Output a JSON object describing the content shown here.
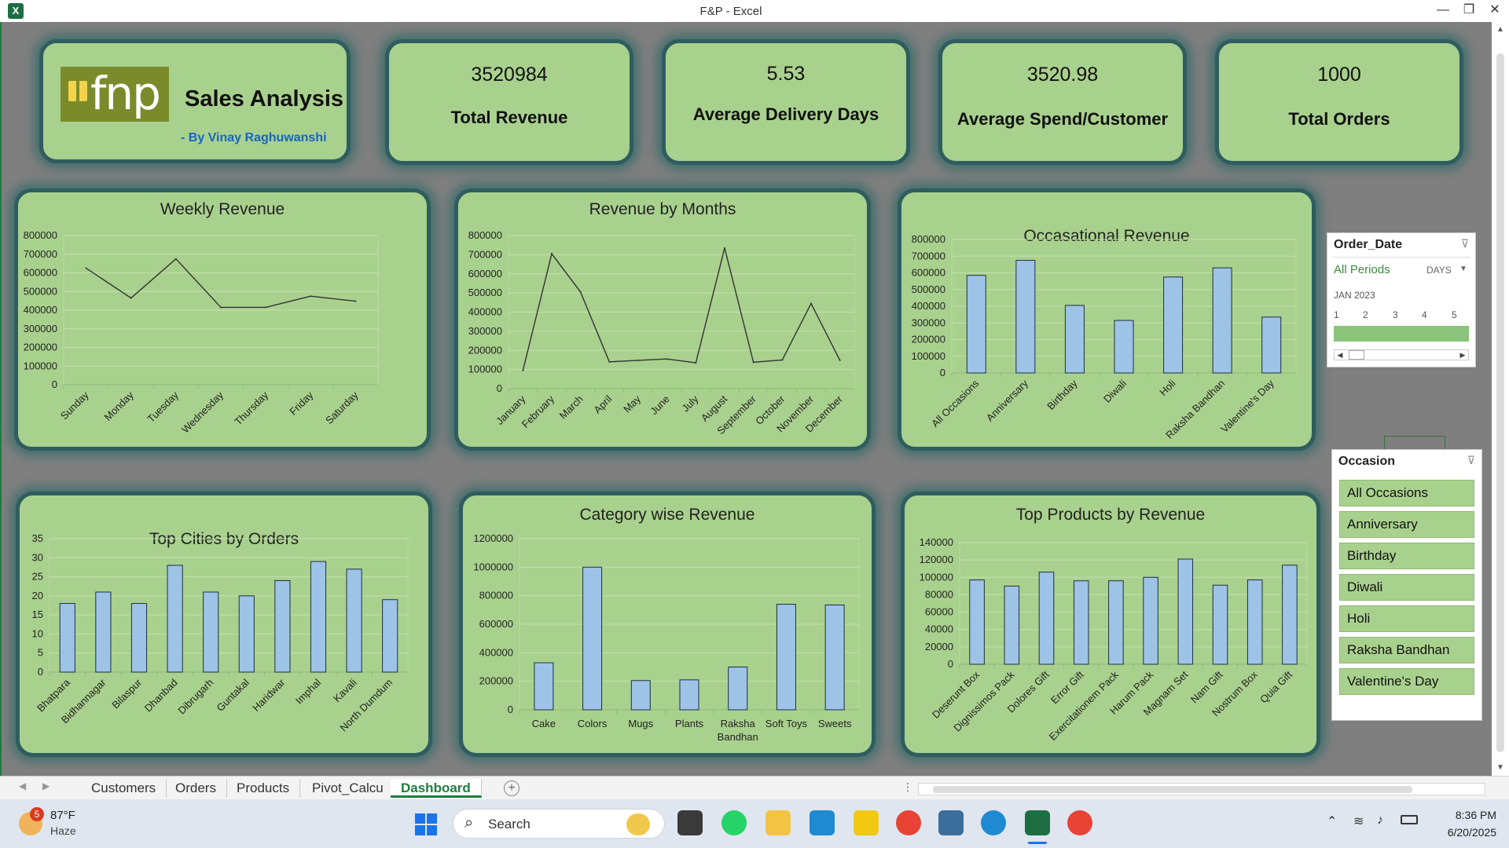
{
  "window": {
    "title": "F&P - Excel",
    "app_icon": "excel-icon"
  },
  "dashboard": {
    "logo": {
      "brand": "fnp",
      "title": "Sales Analysis",
      "author": "- By Vinay Raghuwanshi"
    },
    "kpis": [
      {
        "value": "3520984",
        "label": "Total Revenue"
      },
      {
        "value": "5.53",
        "label": "Average Delivery Days"
      },
      {
        "value": "3520.98",
        "label": "Average Spend/Customer"
      },
      {
        "value": "1000",
        "label": "Total Orders"
      }
    ]
  },
  "chart_data": [
    {
      "type": "line",
      "title": "Weekly Revenue",
      "categories": [
        "Sunday",
        "Monday",
        "Tuesday",
        "Wednesday",
        "Thursday",
        "Friday",
        "Saturday"
      ],
      "values": [
        625000,
        465000,
        675000,
        415000,
        415000,
        475000,
        448000
      ],
      "ylim": [
        0,
        800000
      ],
      "yticks": [
        "800000",
        "700000",
        "600000",
        "500000",
        "400000",
        "300000",
        "200000",
        "100000",
        "0"
      ],
      "grid": true
    },
    {
      "type": "line",
      "title": "Revenue by Months",
      "categories": [
        "January",
        "February",
        "March",
        "April",
        "May",
        "June",
        "July",
        "August",
        "September",
        "October",
        "November",
        "December"
      ],
      "values": [
        95000,
        705000,
        505000,
        140000,
        148000,
        155000,
        135000,
        735000,
        138000,
        150000,
        445000,
        148000
      ],
      "ylim": [
        0,
        800000
      ],
      "yticks": [
        "800000",
        "700000",
        "600000",
        "500000",
        "400000",
        "300000",
        "200000",
        "100000",
        "0"
      ],
      "grid": true
    },
    {
      "type": "bar",
      "title": "Occasational Revenue",
      "categories": [
        "All Occasions",
        "Anniversary",
        "Birthday",
        "Diwali",
        "Holi",
        "Raksha Bandhan",
        "Valentine's Day"
      ],
      "values": [
        585000,
        675000,
        405000,
        315000,
        575000,
        630000,
        335000
      ],
      "ylim": [
        0,
        800000
      ],
      "yticks": [
        "800000",
        "700000",
        "600000",
        "500000",
        "400000",
        "300000",
        "200000",
        "100000",
        "0"
      ],
      "grid": true
    },
    {
      "type": "bar",
      "title": "Top Cities by Orders",
      "categories": [
        "Bhatpara",
        "Bidhannagar",
        "Bilaspur",
        "Dhanbad",
        "Dibrugarh",
        "Guntakal",
        "Haridwar",
        "Imphal",
        "Kavali",
        "North Dumdum"
      ],
      "values": [
        18,
        21,
        18,
        28,
        21,
        20,
        24,
        29,
        27,
        19
      ],
      "ylim": [
        0,
        35
      ],
      "yticks": [
        "35",
        "30",
        "25",
        "20",
        "15",
        "10",
        "5",
        "0"
      ],
      "grid": true
    },
    {
      "type": "bar",
      "title": "Category wise Revenue",
      "categories": [
        "Cake",
        "Colors",
        "Mugs",
        "Plants",
        "Raksha Bandhan",
        "Soft Toys",
        "Sweets"
      ],
      "values": [
        330000,
        1000000,
        205000,
        210000,
        300000,
        740000,
        735000
      ],
      "ylim": [
        0,
        1200000
      ],
      "yticks": [
        "1200000",
        "1000000",
        "800000",
        "600000",
        "400000",
        "200000",
        "0"
      ],
      "grid": true
    },
    {
      "type": "bar",
      "title": "Top Products by Revenue",
      "categories": [
        "Deserunt Box",
        "Dignissimos Pack",
        "Dolores Gift",
        "Error Gift",
        "Exercitationem Pack",
        "Harum Pack",
        "Magnam Set",
        "Nam Gift",
        "Nostrum Box",
        "Quia Gift"
      ],
      "values": [
        97000,
        90000,
        106000,
        96000,
        96000,
        100000,
        121000,
        91000,
        97000,
        114000
      ],
      "ylim": [
        0,
        140000
      ],
      "yticks": [
        "140000",
        "120000",
        "100000",
        "80000",
        "60000",
        "40000",
        "20000",
        "0"
      ],
      "grid": true
    }
  ],
  "slicers": {
    "order_date": {
      "title": "Order_Date",
      "period": "All Periods",
      "unit": "DAYS",
      "month": "JAN 2023",
      "days": [
        "1",
        "2",
        "3",
        "4",
        "5"
      ]
    },
    "occasion": {
      "title": "Occasion",
      "items": [
        "All Occasions",
        "Anniversary",
        "Birthday",
        "Diwali",
        "Holi",
        "Raksha Bandhan",
        "Valentine's Day"
      ]
    }
  },
  "sheet_tabs": [
    "Customers",
    "Orders",
    "Products",
    "Pivot_Calcu",
    "Dashboard"
  ],
  "active_tab": "Dashboard",
  "taskbar": {
    "weather_temp": "87°F",
    "weather_desc": "Haze",
    "weather_badge": "5",
    "search_placeholder": "Search",
    "time": "8:36 PM",
    "date": "6/20/2025",
    "colors": {
      "excel": "#1d6f42",
      "bar": "#9dc3e6"
    }
  }
}
